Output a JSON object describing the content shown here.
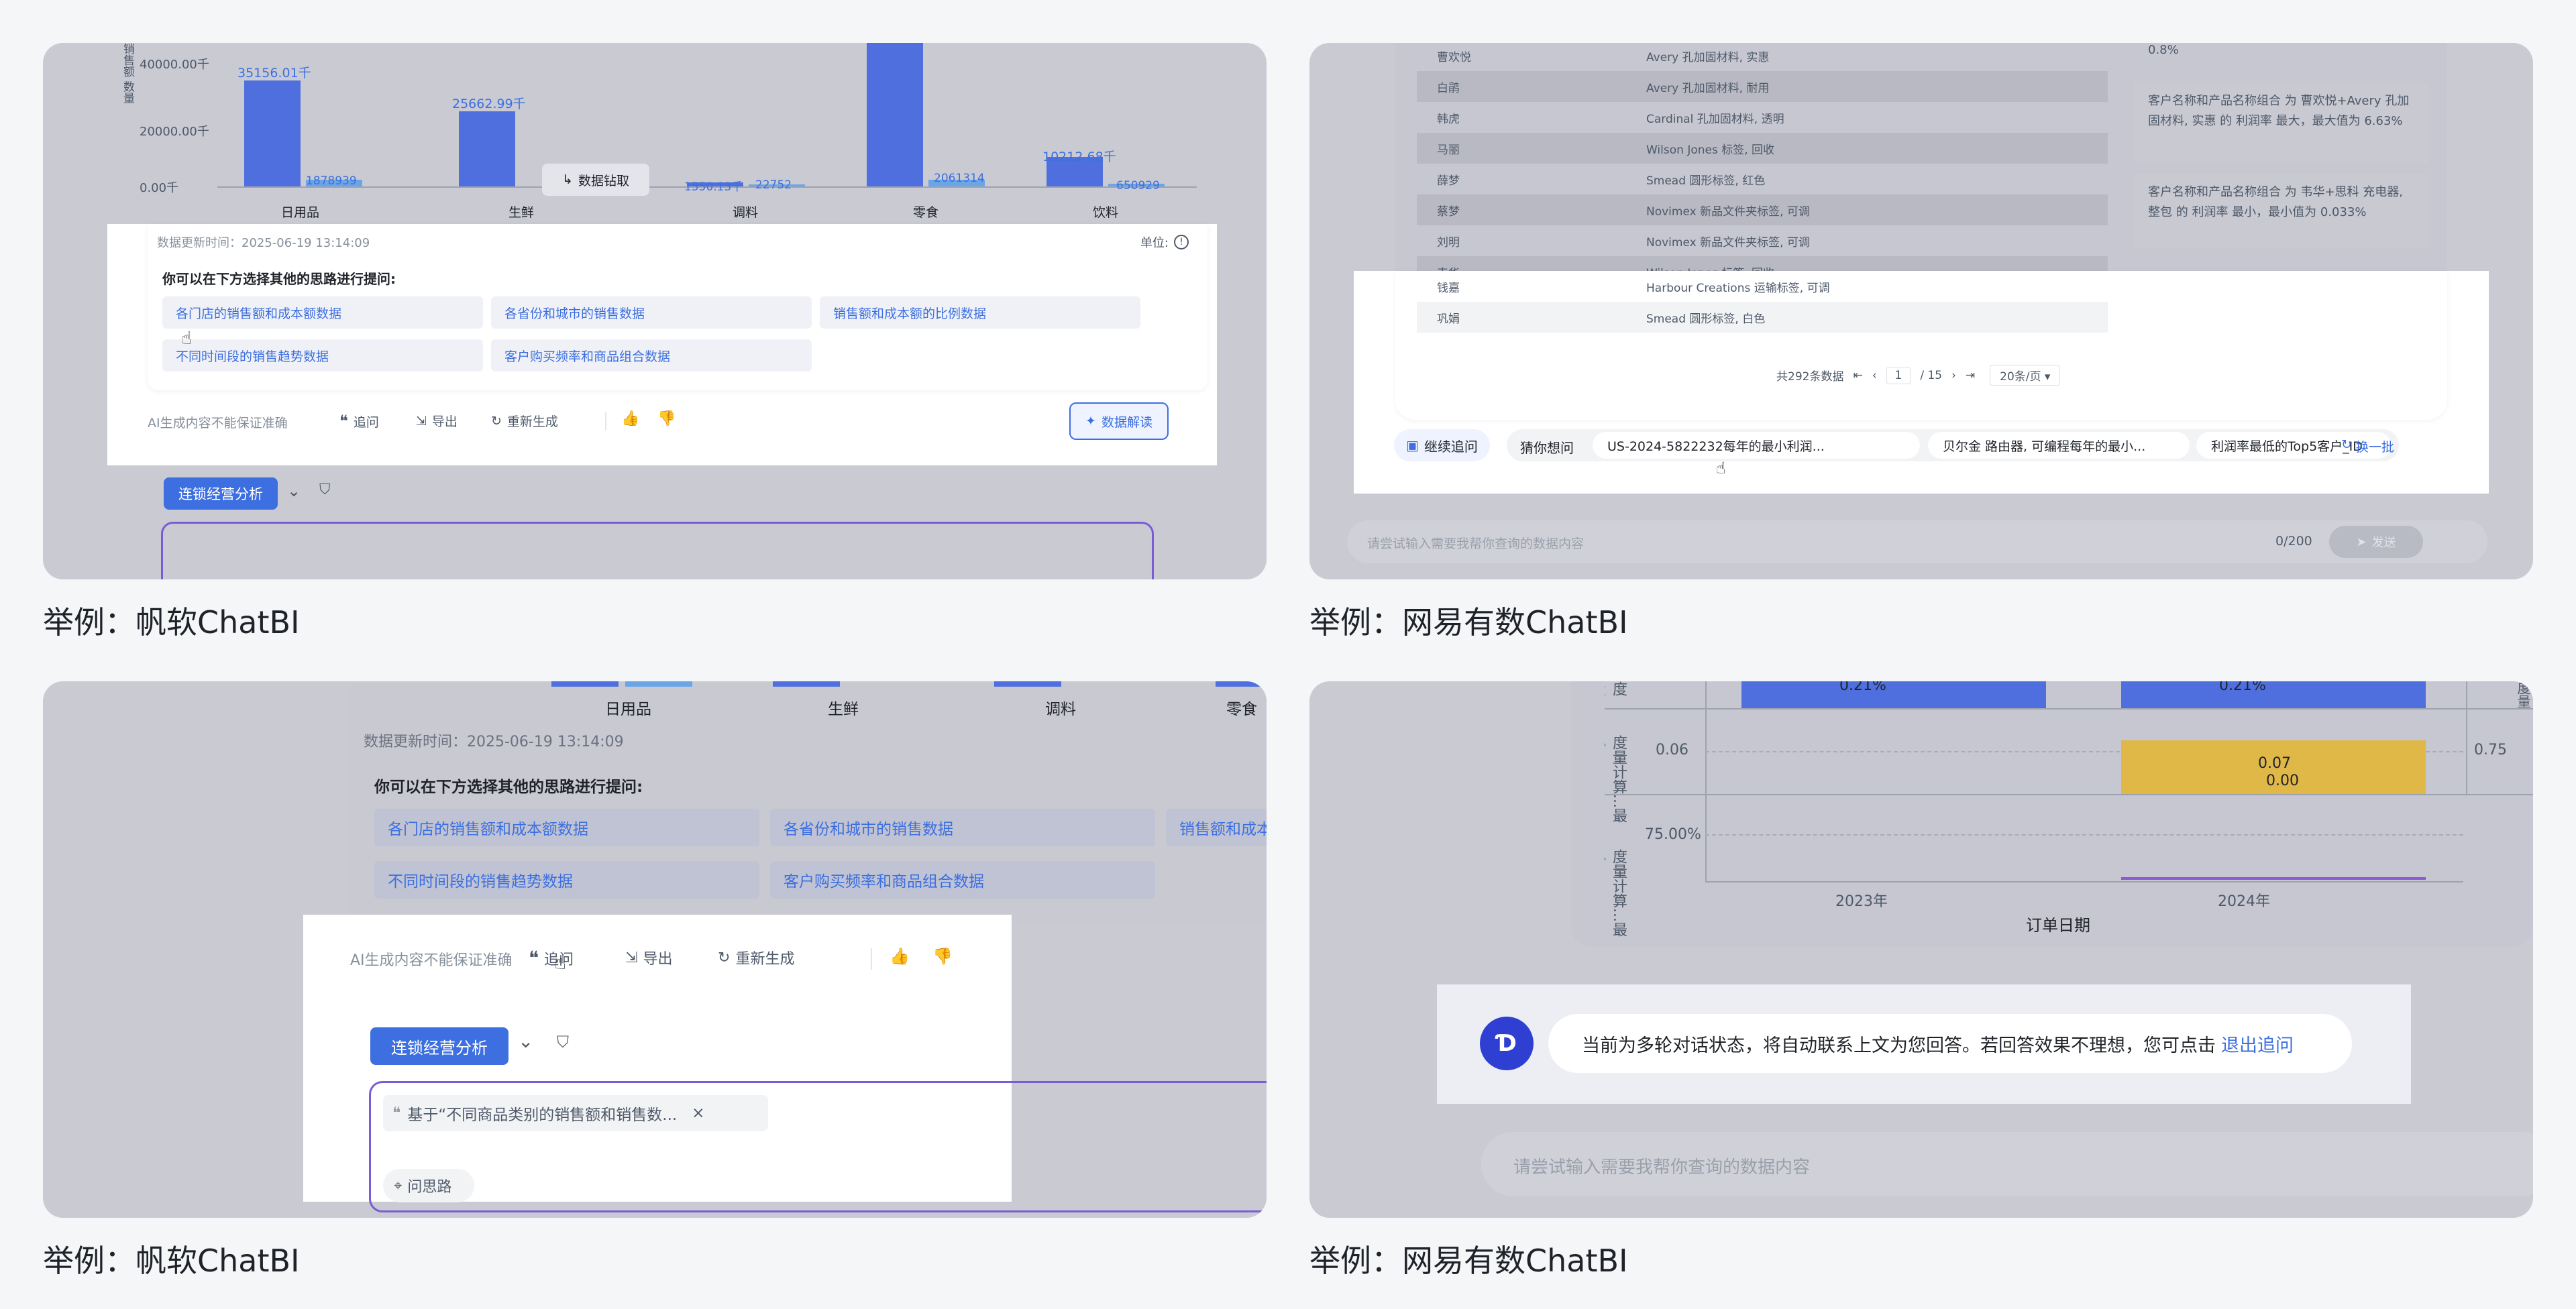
{
  "panel1": {
    "caption": "举例：帆软ChatBI",
    "y_axis_title": "销售额 数量",
    "y_ticks": [
      "40000.00千",
      "20000.00千",
      "0.00千"
    ],
    "categories": [
      "日用品",
      "生鲜",
      "调料",
      "零食",
      "饮料"
    ],
    "bar_labels_a": [
      "35156.01千",
      "25662.99千",
      "1550.13千",
      "",
      "10212.68千"
    ],
    "bar_labels_b": [
      "1878939",
      "",
      "22752",
      "2061314",
      "650929"
    ],
    "drill_button": "数据钻取",
    "update_time": "数据更新时间：2025-06-19 13:14:09",
    "unit": "单位:",
    "prompt_title": "你可以在下方选择其他的思路进行提问:",
    "suggestions": [
      "各门店的销售额和成本额数据",
      "各省份和城市的销售数据",
      "销售额和成本额的比例数据",
      "不同时间段的销售趋势数据",
      "客户购买频率和商品组合数据"
    ],
    "disclaimer": "AI生成内容不能保证准确",
    "actions": {
      "ask": "追问",
      "export": "导出",
      "regenerate": "重新生成"
    },
    "interpret_button": "数据解读",
    "analysis_button": "连锁经营分析"
  },
  "panel2": {
    "caption": "举例：网易有数ChatBI",
    "rows": [
      {
        "name": "曹欢悦",
        "product": "Avery 孔加固材料, 实惠"
      },
      {
        "name": "白鹃",
        "product": "Avery 孔加固材料, 耐用"
      },
      {
        "name": "韩虎",
        "product": "Cardinal 孔加固材料, 透明"
      },
      {
        "name": "马丽",
        "product": "Wilson Jones 标签, 回收"
      },
      {
        "name": "薛梦",
        "product": "Smead 圆形标签, 红色"
      },
      {
        "name": "蔡梦",
        "product": "Novimex 新品文件夹标签, 可调"
      },
      {
        "name": "刘明",
        "product": "Novimex 新品文件夹标签, 可调"
      },
      {
        "name": "韦华",
        "product": "Wilson Jones 标签, 回收"
      },
      {
        "name": "钱嘉",
        "product": "Harbour Creations 运输标签, 可调"
      },
      {
        "name": "巩娟",
        "product": "Smead 圆形标签, 白色"
      }
    ],
    "pagination": {
      "total": "共292条数据",
      "page": "1",
      "pages": "/ 15",
      "page_size": "20条/页"
    },
    "insight_top": "0.8%",
    "insight1": "客户名称和产品名称组合 为 曹欢悦+Avery 孔加固材料, 实惠 的 利润率 最大，最大值为 6.63%",
    "insight2": "客户名称和产品名称组合 为 韦华+思科 充电器, 整包 的 利润率 最小，最小值为 0.033%",
    "continue_button": "继续追问",
    "guess_label": "猜你想问",
    "guess_items": [
      "US-2024-5822232每年的最小利润...",
      "贝尔金 路由器, 可编程每年的最小...",
      "利润率最低的Top5客户_ID"
    ],
    "refresh": "换一批",
    "input_placeholder": "请尝试输入需要我帮你查询的数据内容",
    "counter": "0/200",
    "send": "发送"
  },
  "panel3": {
    "caption": "举例：帆软ChatBI",
    "categories": [
      "日用品",
      "生鲜",
      "调料",
      "零食"
    ],
    "update_time": "数据更新时间：2025-06-19 13:14:09",
    "prompt_title": "你可以在下方选择其他的思路进行提问:",
    "suggestions": [
      "各门店的销售额和成本额数据",
      "各省份和城市的销售数据",
      "销售额和成本额",
      "不同时间段的销售趋势数据",
      "客户购买频率和商品组合数据"
    ],
    "disclaimer": "AI生成内容不能保证准确",
    "actions": {
      "ask": "追问",
      "export": "导出",
      "regenerate": "重新生成"
    },
    "analysis_button": "连锁经营分析",
    "quote_chip": "基于“不同商品类别的销售额和销售数...",
    "idea_button": "问思路"
  },
  "panel4": {
    "caption": "举例：网易有数ChatBI",
    "top_labels": [
      "0.21%",
      "0.21%"
    ],
    "y_ticks_mid": [
      "0.06"
    ],
    "right_tick": "0.75",
    "bar_labels": [
      "0.07",
      "0.00"
    ],
    "y_ticks_low": [
      "75.00%"
    ],
    "axis_titles": [
      "度量计算...最小...",
      "度量计算...最小...",
      "度量计算...最小..."
    ],
    "x_labels": [
      "2023年",
      "2024年"
    ],
    "x_title": "订单日期",
    "notice": "当前为多轮对话状态，将自动联系上文为您回答。若回答效果不理想，您可点击",
    "exit_link": "退出追问",
    "input_placeholder": "请尝试输入需要我帮你查询的数据内容"
  }
}
